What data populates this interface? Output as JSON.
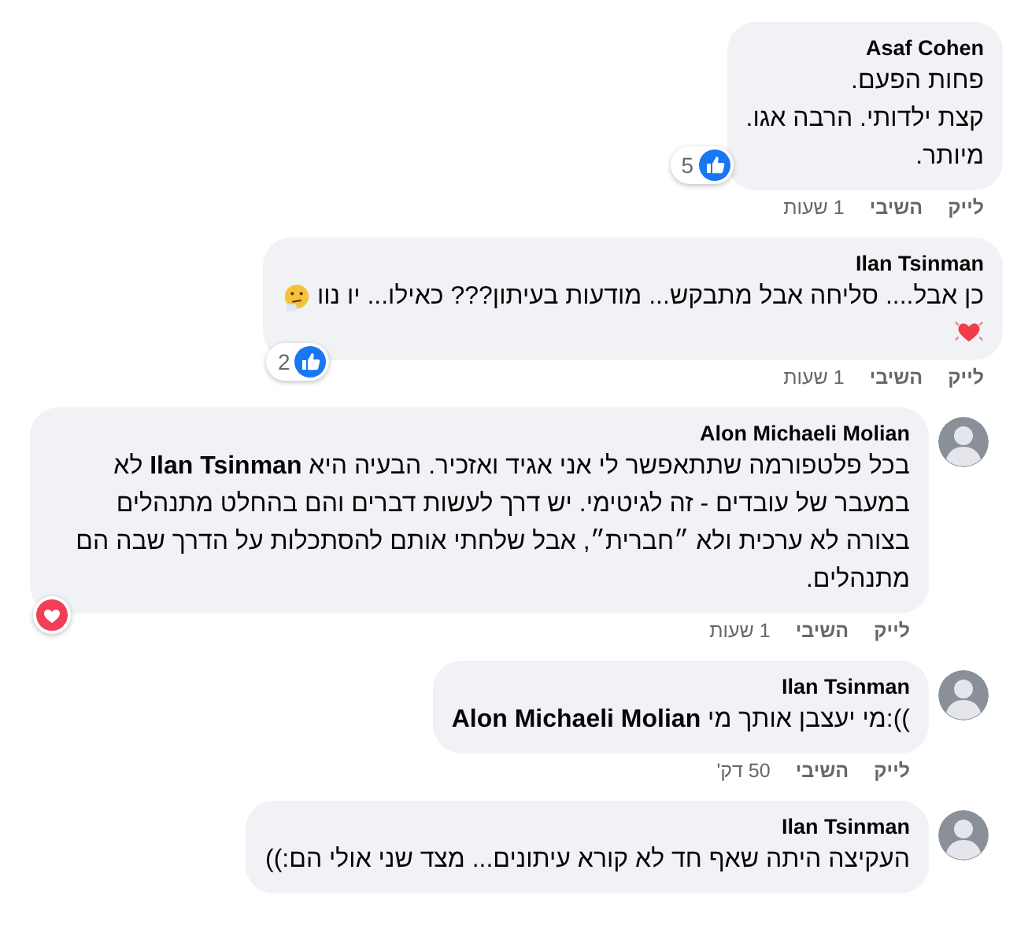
{
  "comments": [
    {
      "author": "Asaf Cohen",
      "avatar": false,
      "lines": [
        "פחות הפעם.",
        "קצת ילדותי. הרבה אגו.",
        "מיותר."
      ],
      "reaction": {
        "kind": "like",
        "count": "5"
      },
      "actions": {
        "like": "לייק",
        "reply": "השיבי",
        "time": "1 שעות"
      }
    },
    {
      "author": "Ilan Tsinman",
      "avatar": false,
      "lines": [
        "כן אבל.... סליחה אבל מתבקש... מודעות בעיתון??? כאילו... יו נוו"
      ],
      "emojis": [
        {
          "kind": "thinking"
        },
        {
          "kind": "heart"
        }
      ],
      "reaction": {
        "kind": "like",
        "count": "2"
      },
      "actions": {
        "like": "לייק",
        "reply": "השיבי",
        "time": "1 שעות"
      }
    },
    {
      "author": "Alon Michaeli Molian",
      "avatar": true,
      "lines": [
        "בכל פלטפורמה שתתאפשר לי אני אגיד ואזכיר. הבעיה היא **Ilan Tsinman** לא במעבר של עובדים - זה לגיטימי. יש דרך לעשות דברים והם בהחלט מתנהלים בצורה לא ערכית ולא ״חברית״, אבל שלחתי אותם להסתכלות על הדרך שבה הם מתנהלים."
      ],
      "reaction": {
        "kind": "love"
      },
      "actions": {
        "like": "לייק",
        "reply": "השיבי",
        "time": "1 שעות"
      }
    },
    {
      "author": "Ilan Tsinman",
      "avatar": true,
      "lines": [
        ")):מי יעצבן אותך מי **Alon Michaeli Molian**"
      ],
      "actions": {
        "like": "לייק",
        "reply": "השיבי",
        "time": "50 דק'"
      }
    },
    {
      "author": "Ilan Tsinman",
      "avatar": true,
      "lines": [
        "העקיצה היתה שאף חד לא קורא עיתונים... מצד שני אולי הם:))"
      ]
    }
  ]
}
